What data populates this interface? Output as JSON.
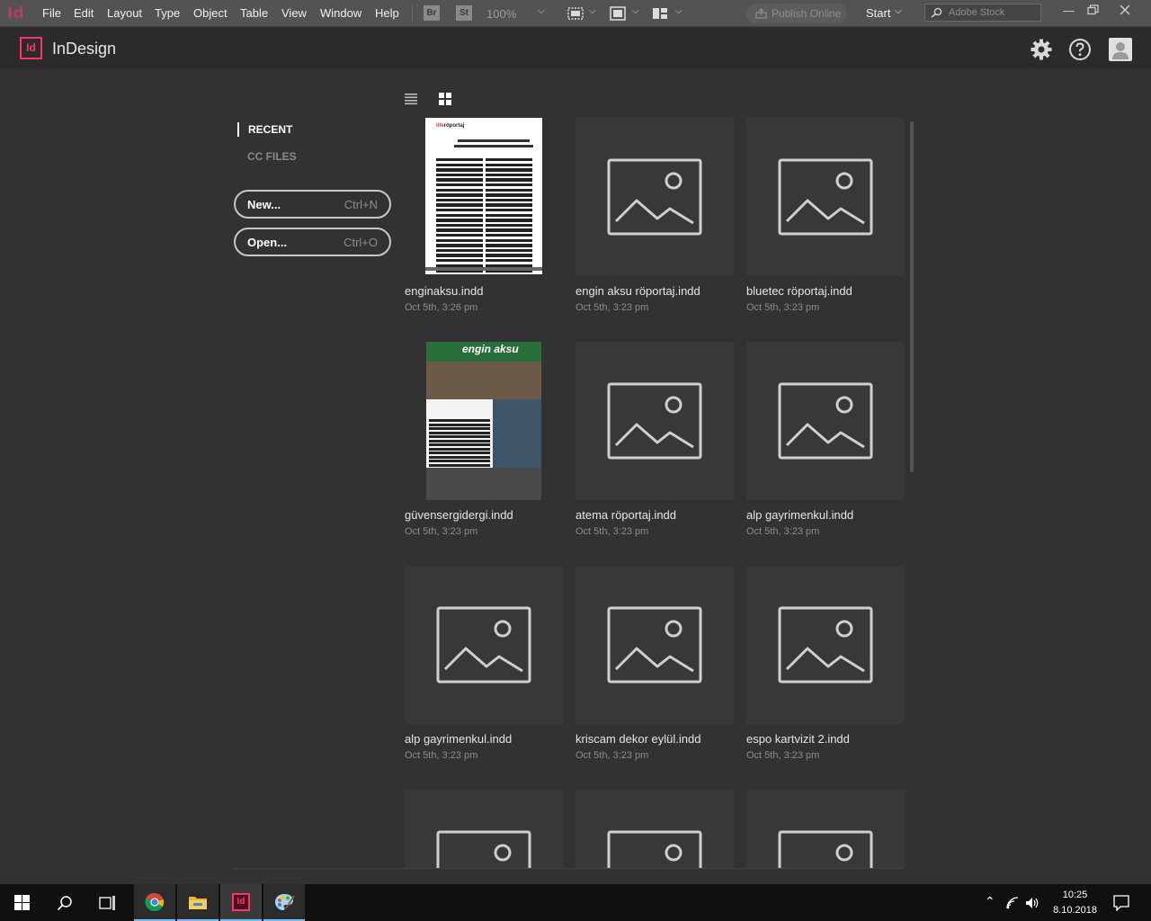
{
  "menubar": {
    "app_glyph": "Id",
    "menus": [
      "File",
      "Edit",
      "Layout",
      "Type",
      "Object",
      "Table",
      "View",
      "Window",
      "Help"
    ],
    "bridge": "Br",
    "stock_btn": "St",
    "zoom": "100%",
    "publish": "Publish Online",
    "workspace": "Start",
    "search_placeholder": "Adobe Stock"
  },
  "header": {
    "logo": "Id",
    "app_name": "InDesign",
    "icons": [
      "gear-icon",
      "help-icon",
      "user-avatar-icon"
    ]
  },
  "sidebar": {
    "recent": "RECENT",
    "cc_files": "CC FILES",
    "new_label": "New...",
    "new_shortcut": "Ctrl+N",
    "open_label": "Open...",
    "open_shortcut": "Ctrl+O"
  },
  "files": [
    {
      "name": "enginaksu.indd",
      "date": "Oct 5th, 3:26 pm",
      "thumb": "doc"
    },
    {
      "name": "engin aksu röportaj.indd",
      "date": "Oct 5th, 3:23 pm",
      "thumb": "placeholder"
    },
    {
      "name": "bluetec röportaj.indd",
      "date": "Oct 5th, 3:23 pm",
      "thumb": "placeholder"
    },
    {
      "name": "güvensergidergi.indd",
      "date": "Oct 5th, 3:23 pm",
      "thumb": "magazine"
    },
    {
      "name": "atema röportaj.indd",
      "date": "Oct 5th, 3:23 pm",
      "thumb": "placeholder"
    },
    {
      "name": "alp gayrimenkul.indd",
      "date": "Oct 5th, 3:23 pm",
      "thumb": "placeholder"
    },
    {
      "name": "alp gayrimenkul.indd",
      "date": "Oct 5th, 3:23 pm",
      "thumb": "placeholder"
    },
    {
      "name": "kriscam dekor eylül.indd",
      "date": "Oct 5th, 3:23 pm",
      "thumb": "placeholder"
    },
    {
      "name": "espo kartvizit 2.indd",
      "date": "Oct 5th, 3:23 pm",
      "thumb": "placeholder"
    }
  ],
  "thumb_text": {
    "doc_brand": "life",
    "doc_brand2": "röportaj",
    "mag_title": "engin aksu"
  },
  "taskbar": {
    "time": "10:25",
    "date": "8.10.2018"
  },
  "colors": {
    "accent": "#ff3366",
    "bg": "#323232",
    "tile": "#383838",
    "taskbar_active": "#76b9ed"
  }
}
